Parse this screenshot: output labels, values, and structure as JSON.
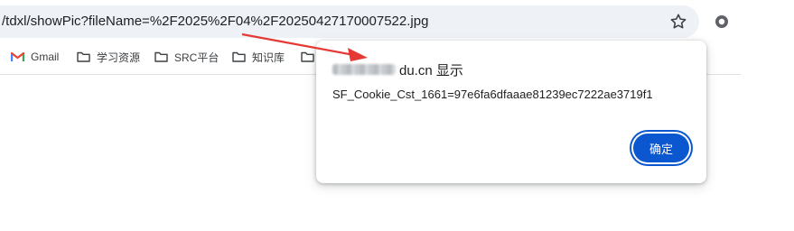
{
  "address_bar": {
    "url": "/tdxl/showPic?fileName=%2F2025%2F04%2F20250427170007522.jpg",
    "star_icon": "star-outline-icon",
    "extension_icon": "extension-circle-icon"
  },
  "bookmarks": [
    {
      "label": "Gmail",
      "icon": "gmail-icon"
    },
    {
      "label": "学习资源",
      "icon": "folder-icon"
    },
    {
      "label": "SRC平台",
      "icon": "folder-icon"
    },
    {
      "label": "知识库",
      "icon": "folder-icon"
    },
    {
      "label": "",
      "icon": "folder-icon"
    }
  ],
  "dialog": {
    "title": "du.cn 显示",
    "message": "SF_Cookie_Cst_1661=97e6fa6dfaaae81239ec7222ae3719f1",
    "ok_label": "确定"
  },
  "colors": {
    "accent": "#0b57d0",
    "annotation_arrow": "#e53935",
    "omnibox_bg": "#eef1f6",
    "gmail_red": "#ea4335"
  }
}
